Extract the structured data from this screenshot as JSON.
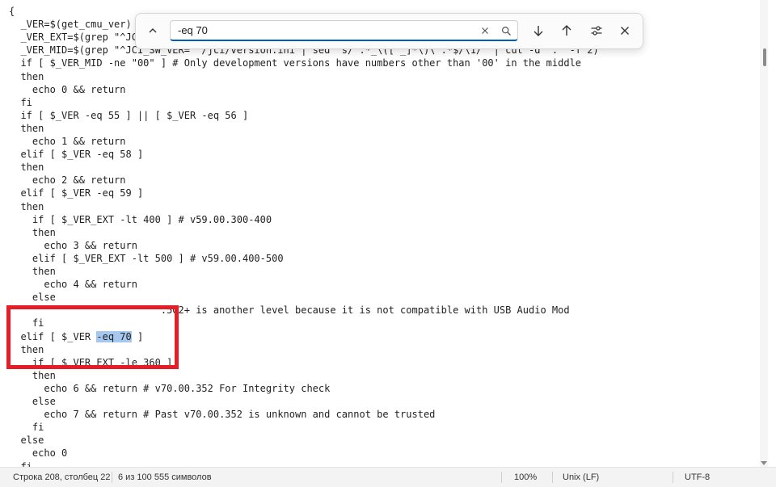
{
  "editor": {
    "lines": [
      {
        "text": "{"
      },
      {
        "text": "  _VER=$(get_cmu_ver)"
      },
      {
        "text": "  _VER_EXT=$(grep \"^JCI"
      },
      {
        "text": "  _VER_MID=$(grep \"^JCI_SW_VER=\" /jci/version.ini | sed 's/^.*_\\([^_]*\\)\\\".*$/\\1/' | cut -d '.' -f 2)"
      },
      {
        "text": "  if [ $_VER_MID -ne \"00\" ] # Only development versions have numbers other than '00' in the middle"
      },
      {
        "text": "  then"
      },
      {
        "text": "    echo 0 && return"
      },
      {
        "text": "  fi"
      },
      {
        "text": "  if [ $_VER -eq 55 ] || [ $_VER -eq 56 ]"
      },
      {
        "text": "  then"
      },
      {
        "text": "    echo 1 && return"
      },
      {
        "text": "  elif [ $_VER -eq 58 ]"
      },
      {
        "text": "  then"
      },
      {
        "text": "    echo 2 && return"
      },
      {
        "text": "  elif [ $_VER -eq 59 ]"
      },
      {
        "text": "  then"
      },
      {
        "text": "    if [ $_VER_EXT -lt 400 ] # v59.00.300-400"
      },
      {
        "text": "    then"
      },
      {
        "text": "      echo 3 && return"
      },
      {
        "text": "    elif [ $_VER_EXT -lt 500 ] # v59.00.400-500"
      },
      {
        "text": "    then"
      },
      {
        "text": "      echo 4 && return"
      },
      {
        "text": "    else"
      },
      {
        "text": "                          .502+ is another level because it is not compatible with USB Audio Mod"
      },
      {
        "text": "    fi"
      },
      {
        "before": "  elif [ $_VER ",
        "match": "-eq 70",
        "after": " ]"
      },
      {
        "text": "  then"
      },
      {
        "text": "    if [ $_VER_EXT -le 360 ]"
      },
      {
        "text": "    then"
      },
      {
        "text": "      echo 6 && return # v70.00.352 For Integrity check"
      },
      {
        "text": "    else"
      },
      {
        "text": "      echo 7 && return # Past v70.00.352 is unknown and cannot be trusted"
      },
      {
        "text": "    fi"
      },
      {
        "text": "  else"
      },
      {
        "text": "    echo 0"
      },
      {
        "text": "  fi"
      }
    ]
  },
  "find": {
    "query": "-eq 70",
    "colors": {
      "accent": "#005fb8"
    }
  },
  "annotation": {
    "color": "#e41e26"
  },
  "status": {
    "position": "Строка 208, столбец 22",
    "selection": "6 из 100 555 символов",
    "zoom": "100%",
    "line_ending": "Unix (LF)",
    "encoding": "UTF-8"
  }
}
